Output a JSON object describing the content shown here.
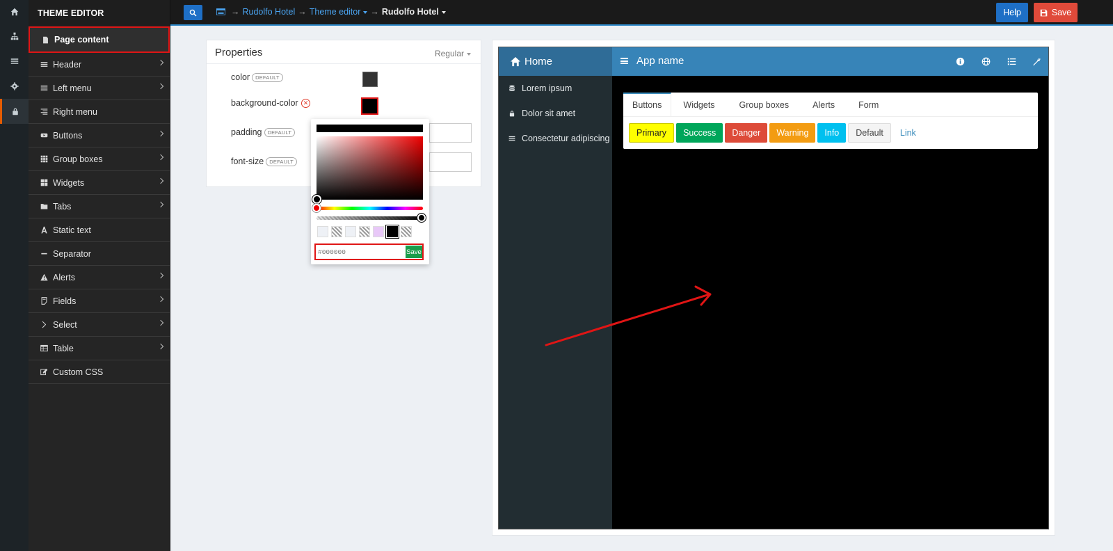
{
  "rail": {
    "icons": [
      "home-icon",
      "sitemap-icon",
      "menu-icon",
      "gear-icon",
      "lock-icon"
    ]
  },
  "sidebar": {
    "title": "THEME EDITOR",
    "items": [
      {
        "label": "Page content",
        "icon": "file-icon",
        "has_chevron": false
      },
      {
        "label": "Header",
        "icon": "menu-icon",
        "has_chevron": true
      },
      {
        "label": "Left menu",
        "icon": "menu-icon",
        "has_chevron": true
      },
      {
        "label": "Right menu",
        "icon": "align-right-icon",
        "has_chevron": false
      },
      {
        "label": "Buttons",
        "icon": "button-icon",
        "has_chevron": true
      },
      {
        "label": "Group boxes",
        "icon": "grid-icon",
        "has_chevron": true
      },
      {
        "label": "Widgets",
        "icon": "widgets-icon",
        "has_chevron": true
      },
      {
        "label": "Tabs",
        "icon": "folder-icon",
        "has_chevron": true
      },
      {
        "label": "Static text",
        "icon": "text-icon",
        "has_chevron": false
      },
      {
        "label": "Separator",
        "icon": "minus-icon",
        "has_chevron": false
      },
      {
        "label": "Alerts",
        "icon": "warning-icon",
        "has_chevron": true
      },
      {
        "label": "Fields",
        "icon": "field-icon",
        "has_chevron": true
      },
      {
        "label": "Select",
        "icon": "select-icon",
        "has_chevron": true
      },
      {
        "label": "Table",
        "icon": "table-icon",
        "has_chevron": true
      },
      {
        "label": "Custom CSS",
        "icon": "edit-icon",
        "has_chevron": false
      }
    ]
  },
  "topbar": {
    "breadcrumb": [
      "Rudolfo Hotel",
      "Theme editor",
      "Rudolfo Hotel"
    ],
    "help_label": "Help",
    "save_label": "Save"
  },
  "properties": {
    "title": "Properties",
    "mode": "Regular",
    "default_badge": "DEFAULT",
    "rows": [
      {
        "name": "color",
        "badge": true,
        "swatch": "#333333"
      },
      {
        "name": "background-color",
        "badge": false,
        "swatch": "#000000"
      },
      {
        "name": "padding",
        "badge": true
      },
      {
        "name": "font-size",
        "badge": true
      }
    ]
  },
  "picker": {
    "value_placeholder": "#000000",
    "save_label": "Save",
    "swatches": [
      "#eef1f6",
      "checker",
      "#eef1f6",
      "checker",
      "#e8c8f8",
      "#000000",
      "checker"
    ]
  },
  "preview": {
    "home_label": "Home",
    "app_name": "App name",
    "left_items": [
      {
        "label": "Lorem ipsum",
        "icon": "database-icon"
      },
      {
        "label": "Dolor sit amet",
        "icon": "lock-icon"
      },
      {
        "label": "Consectetur adipiscing",
        "icon": "menu-icon"
      }
    ],
    "tabs": [
      "Buttons",
      "Widgets",
      "Group boxes",
      "Alerts",
      "Form"
    ],
    "buttons": [
      "Primary",
      "Success",
      "Danger",
      "Warning",
      "Info",
      "Default",
      "Link"
    ],
    "toolbar_icons": [
      "info-icon",
      "globe-icon",
      "list-icon",
      "wrench-icon"
    ]
  },
  "colors": {
    "accent_blue": "#1e6fc6",
    "save_red": "#e04a3a",
    "preview_background": "#000000",
    "highlight_red": "#e01515"
  }
}
